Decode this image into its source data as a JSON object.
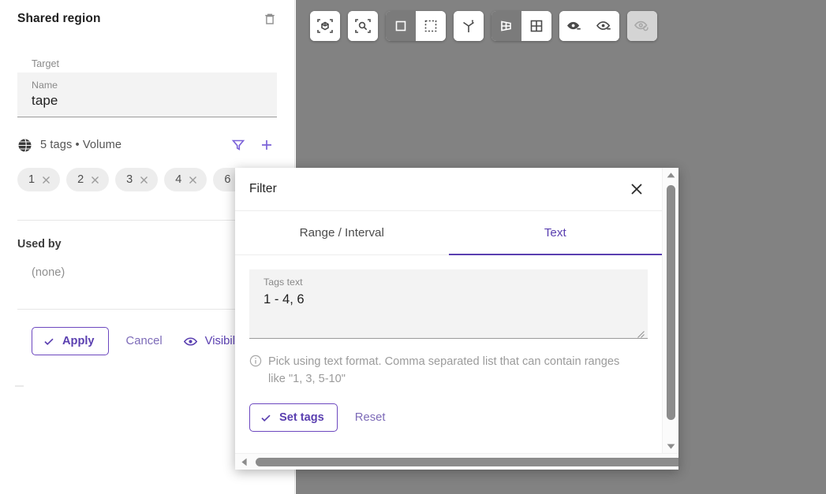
{
  "panel": {
    "title": "Shared region",
    "delete_icon": "trash-icon",
    "target_label": "Target",
    "name_label": "Name",
    "name_value": "tape",
    "tags_icon": "globe-icon",
    "tags_summary": "5 tags • Volume",
    "filter_icon": "filter-funnel-icon",
    "add_icon": "plus-icon",
    "chips": [
      {
        "label": "1",
        "remove_icon": "close-icon"
      },
      {
        "label": "2",
        "remove_icon": "close-icon"
      },
      {
        "label": "3",
        "remove_icon": "close-icon"
      },
      {
        "label": "4",
        "remove_icon": "close-icon"
      },
      {
        "label": "6",
        "remove_icon": "close-icon"
      }
    ],
    "used_by_title": "Used by",
    "used_by_value": "(none)",
    "apply_label": "Apply",
    "apply_icon": "check-icon",
    "cancel_label": "Cancel",
    "visibility_label": "Visibil",
    "visibility_icon": "eye-icon",
    "accent_color": "#5a3fb0",
    "chip_bg": "#ededed",
    "field_bg": "#f3f3f3"
  },
  "toolbar": {
    "groups": [
      {
        "buttons": [
          {
            "name": "frame-object-icon",
            "state": "on"
          }
        ]
      },
      {
        "buttons": [
          {
            "name": "zoom-to-fit-icon",
            "state": "on"
          }
        ]
      },
      {
        "buttons": [
          {
            "name": "solid-square-icon",
            "state": "off"
          },
          {
            "name": "dashed-square-icon",
            "state": "on"
          }
        ]
      },
      {
        "buttons": [
          {
            "name": "axes-3d-icon",
            "state": "on"
          }
        ]
      },
      {
        "buttons": [
          {
            "name": "single-pane-layout-icon",
            "state": "off"
          },
          {
            "name": "quad-pane-layout-icon",
            "state": "on"
          }
        ]
      },
      {
        "buttons": [
          {
            "name": "eye-minus-filled-icon",
            "state": "on"
          },
          {
            "name": "eye-minus-outline-icon",
            "state": "on"
          }
        ]
      },
      {
        "buttons": [
          {
            "name": "eye-reset-icon",
            "state": "disabled"
          }
        ]
      }
    ]
  },
  "dialog": {
    "title": "Filter",
    "close_icon": "close-icon",
    "tabs": [
      {
        "label": "Range / Interval",
        "active": false
      },
      {
        "label": "Text",
        "active": true
      }
    ],
    "tags_text_label": "Tags text",
    "tags_text_value": "1 - 4, 6",
    "tags_text_placeholder": "Tags text",
    "hint_icon": "info-icon",
    "hint_text": "Pick using text format. Comma separated list that can contain ranges like \"1, 3, 5-10\"",
    "set_tags_label": "Set tags",
    "set_tags_icon": "check-icon",
    "reset_label": "Reset",
    "accent_color": "#5a3fb0",
    "scroll": {
      "vertical_up_icon": "caret-up-icon",
      "vertical_down_icon": "caret-down-icon",
      "horizontal_left_icon": "caret-left-icon",
      "horizontal_right_icon": "caret-right-icon"
    }
  },
  "viewport": {
    "background_color": "#828282",
    "shape_name": "tape-region",
    "shape_fill": "#e00000",
    "shape_outline": "#1d00c8"
  }
}
